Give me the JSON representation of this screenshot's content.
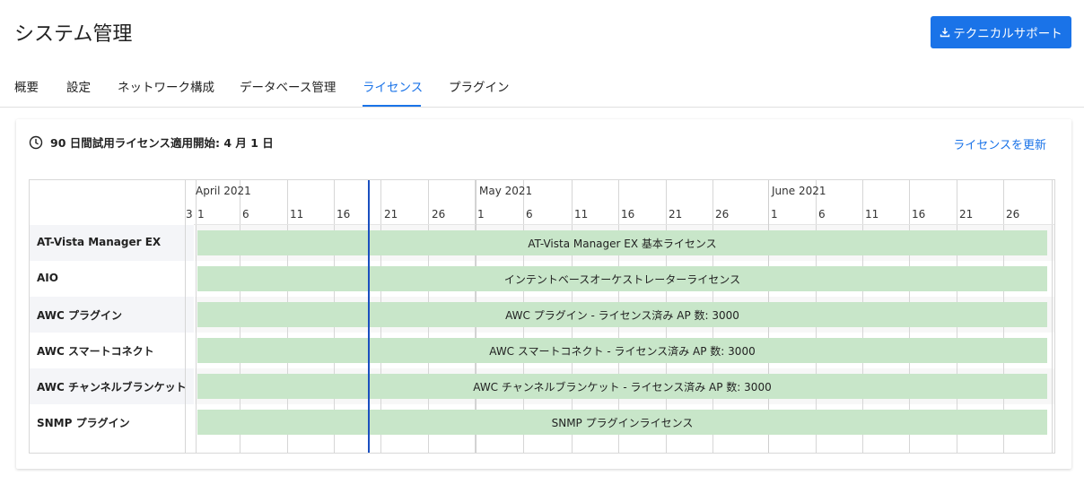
{
  "header": {
    "title": "システム管理",
    "support_button": "テクニカルサポート"
  },
  "tabs": [
    {
      "label": "概要",
      "active": false
    },
    {
      "label": "設定",
      "active": false
    },
    {
      "label": "ネットワーク構成",
      "active": false
    },
    {
      "label": "データベース管理",
      "active": false
    },
    {
      "label": "ライセンス",
      "active": true
    },
    {
      "label": "プラグイン",
      "active": false
    }
  ],
  "license": {
    "trial_text": "90 日間試用ライセンス適用開始: 4 月 1 日",
    "update_link": "ライセンスを更新"
  },
  "timeline": {
    "months": [
      "April 2021",
      "May 2021",
      "June 2021"
    ],
    "days": [
      "3",
      "1",
      "6",
      "11",
      "16",
      "21",
      "26",
      "1",
      "6",
      "11",
      "16",
      "21",
      "26",
      "1",
      "6",
      "11",
      "16",
      "21",
      "26"
    ],
    "rows": [
      {
        "label": "AT-Vista Manager EX",
        "bar": "AT-Vista Manager EX 基本ライセンス"
      },
      {
        "label": "AIO",
        "bar": "インテントベースオーケストレーターライセンス"
      },
      {
        "label": "AWC プラグイン",
        "bar": "AWC プラグイン - ライセンス済み AP 数: 3000"
      },
      {
        "label": "AWC スマートコネクト",
        "bar": "AWC スマートコネクト - ライセンス済み AP 数: 3000"
      },
      {
        "label": "AWC チャンネルブランケット",
        "bar": "AWC チャンネルブランケット - ライセンス済み AP 数: 3000"
      },
      {
        "label": "SNMP プラグイン",
        "bar": "SNMP プラグインライセンス"
      }
    ]
  },
  "colors": {
    "accent": "#1a73e8",
    "bar": "#c8e6c9",
    "today_line": "#1a4fbf"
  }
}
